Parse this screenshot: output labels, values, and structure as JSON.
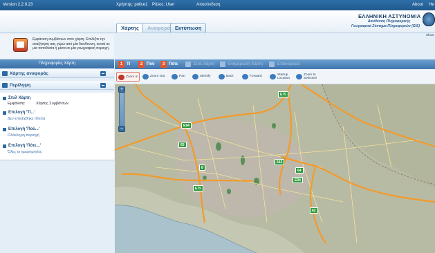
{
  "topbar": {
    "version": "Version 2.2.0.23",
    "user": "Χρήστης: police1",
    "role": "Ρόλος: User",
    "logout": "Αποσύνδεση",
    "about": "About",
    "help": "He"
  },
  "tabs": [
    {
      "label": "Χάρτης",
      "state": "active"
    },
    {
      "label": "Αναφορά",
      "state": "disabled"
    },
    {
      "label": "Εκτύπωση",
      "state": "normal"
    }
  ],
  "brand": {
    "title": "ΕΛΛΗΝΙΚΗ ΑΣΤΥΝΟΜΙΑ",
    "line2": "Διεύθυνση Πληροφορικής",
    "line3": "Γεωγραφικό Σύστημα Πληροφοριών (GIS)",
    "show": "Show"
  },
  "intro": {
    "text": "Εμφάνιση συμβάντων στον χάρτη. Επιλέξτε την αναζήτηση σας γύρω από μία διεύθυνση, κοντά σε μία τοποθεσία ή μέσα σε μία γεωγραφική περιοχή."
  },
  "left_panel": {
    "title": "Πληροφορίες Χάρτη",
    "sections": [
      {
        "label": "Χάρτης αναφοράς"
      },
      {
        "label": "Περίληψη"
      }
    ],
    "summary": {
      "g1": "Στυλ Χάρτη",
      "g1_key": "Εμφάνιση:",
      "g1_val": "Χάρτης Συμβάντων",
      "g2": "Επιλογή 'Τί...'",
      "g2_val": "Δεν επιλέχθηκε τίποτα",
      "g3": "Επιλογή 'Πού...'",
      "g3_val": "Ολόκληρη περιοχή",
      "g4": "Επιλογή 'Πότε...'",
      "g4_val": "Όλες οι ημερομηνίες"
    }
  },
  "steps": [
    {
      "num": "1",
      "label": "Τί"
    },
    {
      "num": "2",
      "label": "Πού"
    },
    {
      "num": "3",
      "label": "Πότε"
    },
    {
      "label": "Στυλ Χάρτη"
    },
    {
      "label": "Ενημέρωση Χάρτη"
    },
    {
      "label": "Επαναφορά"
    }
  ],
  "tools": [
    {
      "label": "Zoom In"
    },
    {
      "label": "Zoom Out"
    },
    {
      "label": "Pan"
    },
    {
      "label": "Identify"
    },
    {
      "label": "Back"
    },
    {
      "label": "Forward"
    },
    {
      "label": "Startup Location"
    },
    {
      "label": "Zoom to Selected"
    }
  ],
  "map": {
    "markers": [
      "E75",
      "E94",
      "65",
      "8",
      "642",
      "64",
      "E94",
      "E75",
      "62"
    ]
  },
  "colors": {
    "accent": "#3f76ae",
    "step_badge": "#e2562e",
    "motorway": "#f39a2b",
    "marker": "#2f9a3e"
  }
}
